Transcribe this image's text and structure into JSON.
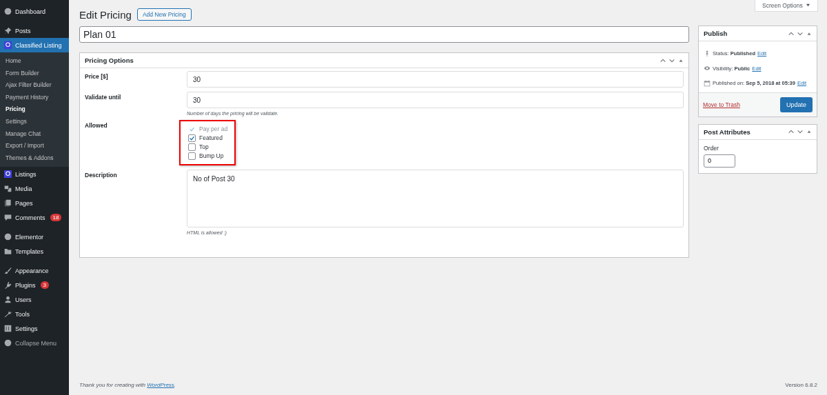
{
  "sidebar": {
    "groups": [
      [
        {
          "label": "Dashboard",
          "selected": false
        }
      ],
      [
        {
          "label": "Posts",
          "selected": false
        },
        {
          "label": "Classified Listing",
          "selected": true,
          "children": [
            {
              "label": "Home",
              "selected": false
            },
            {
              "label": "Form Builder",
              "selected": false
            },
            {
              "label": "Ajax Filter Builder",
              "selected": false
            },
            {
              "label": "Payment History",
              "selected": false
            },
            {
              "label": "Pricing",
              "selected": true
            },
            {
              "label": "Settings",
              "selected": false
            },
            {
              "label": "Manage Chat",
              "selected": false
            },
            {
              "label": "Export / Import",
              "selected": false
            },
            {
              "label": "Themes & Addons",
              "selected": false
            }
          ]
        },
        {
          "label": "Listings",
          "selected": false
        },
        {
          "label": "Media",
          "selected": false
        },
        {
          "label": "Pages",
          "selected": false
        },
        {
          "label": "Comments",
          "selected": false,
          "badge": "18"
        }
      ],
      [
        {
          "label": "Elementor",
          "selected": false
        },
        {
          "label": "Templates",
          "selected": false
        }
      ],
      [
        {
          "label": "Appearance",
          "selected": false
        },
        {
          "label": "Plugins",
          "selected": false,
          "badge": "3"
        },
        {
          "label": "Users",
          "selected": false
        },
        {
          "label": "Tools",
          "selected": false
        },
        {
          "label": "Settings",
          "selected": false
        },
        {
          "label": "Collapse Menu",
          "selected": false
        }
      ]
    ]
  },
  "screen_options": "Screen Options",
  "page_title": "Edit Pricing",
  "add_new_button": "Add New Pricing",
  "post_title": "Plan 01",
  "pricing_box": {
    "title": "Pricing Options",
    "fields": [
      {
        "kind": "input",
        "label": "Price [$]",
        "value": "30"
      },
      {
        "kind": "input",
        "label": "Validate until",
        "value": "30",
        "hint": "Number of days the pricing will be validate."
      },
      {
        "kind": "checkboxes",
        "label": "Allowed",
        "highlighted": true,
        "options": [
          {
            "label": "Pay per ad",
            "checked": true,
            "disabled": true
          },
          {
            "label": "Featured",
            "checked": true,
            "disabled": false
          },
          {
            "label": "Top",
            "checked": false,
            "disabled": false
          },
          {
            "label": "Bump Up",
            "checked": false,
            "disabled": false
          }
        ]
      },
      {
        "kind": "textarea",
        "label": "Description",
        "value": "No of Post 30",
        "hint": "HTML is allowed :)"
      }
    ]
  },
  "publish_box": {
    "title": "Publish",
    "rows": [
      {
        "label": "Status:",
        "value": "Published",
        "link": "Edit"
      },
      {
        "label": "Visibility:",
        "value": "Public",
        "link": "Edit"
      },
      {
        "label": "Published on:",
        "value": "Sep 5, 2018 at 05:39",
        "link": "Edit"
      }
    ],
    "trash_link": "Move to Trash",
    "update_button": "Update"
  },
  "attributes_box": {
    "title": "Post Attributes",
    "order_label": "Order",
    "order_value": "0"
  },
  "footer": {
    "text": "Thank you for creating with",
    "link": "WordPress",
    "after": ".",
    "version": "Version 6.8.2"
  }
}
